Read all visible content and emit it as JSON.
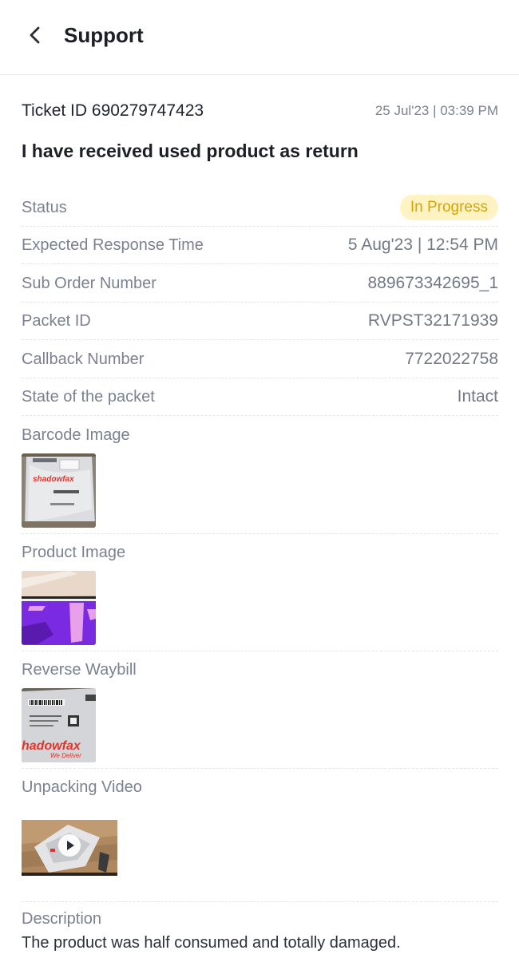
{
  "header": {
    "title": "Support",
    "back_icon": "chevron-left-icon"
  },
  "ticket": {
    "id_text": "Ticket ID 690279747423",
    "date": "25 Jul'23 | 03:39 PM",
    "issue": "I have received used product as return"
  },
  "details": [
    {
      "label": "Status",
      "value": "In Progress"
    },
    {
      "label": "Expected Response Time",
      "value": "5 Aug'23 | 12:54 PM"
    },
    {
      "label": "Sub Order Number",
      "value": "889673342695_1"
    },
    {
      "label": "Packet ID",
      "value": "RVPST32171939"
    },
    {
      "label": "Callback Number",
      "value": "7722022758"
    },
    {
      "label": "State of the packet",
      "value": "Intact"
    }
  ],
  "media": {
    "barcode_label": "Barcode Image",
    "product_label": "Product Image",
    "waybill_label": "Reverse Waybill",
    "video_label": "Unpacking Video",
    "barcode_brand": "shadowfax",
    "waybill_brand": "hadowfax",
    "waybill_tagline": "We Deliver"
  },
  "description": {
    "label": "Description",
    "text": "The product was half consumed and totally damaged."
  },
  "colors": {
    "status_bg": "#fff3c4",
    "status_text": "#d7a400",
    "label_gray": "#7b8191"
  }
}
